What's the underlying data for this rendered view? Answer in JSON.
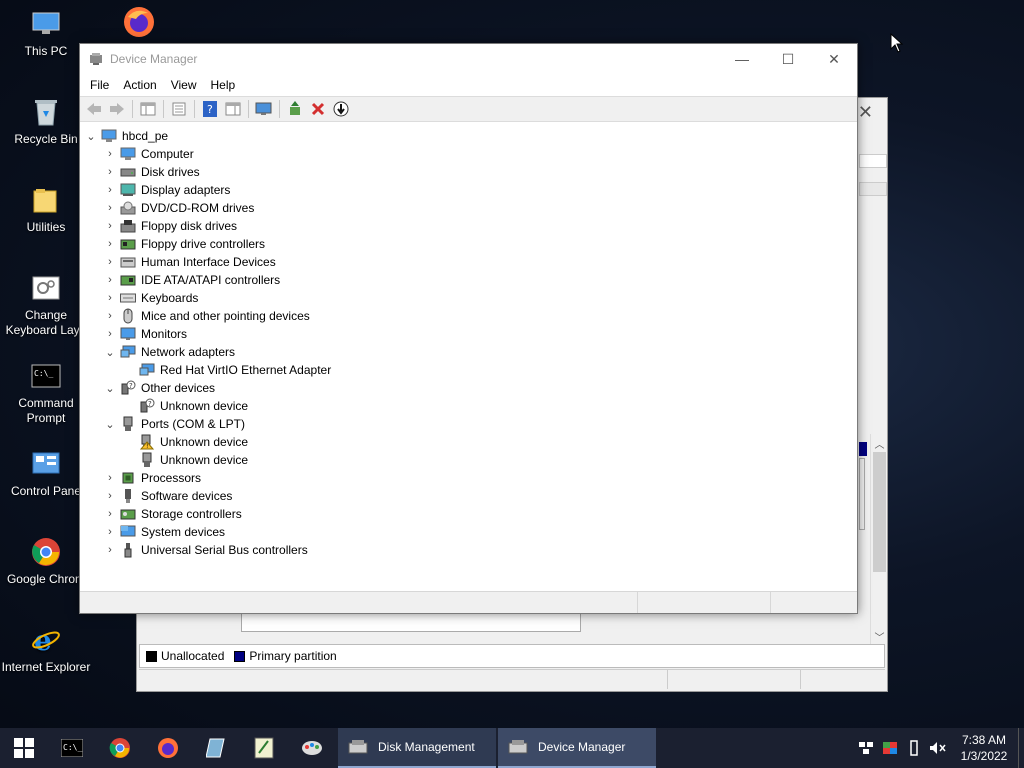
{
  "desktop": {
    "icons": [
      {
        "label": "This PC",
        "icon": "this-pc-icon"
      },
      {
        "label": "Recycle Bin",
        "icon": "recycle-bin-icon"
      },
      {
        "label": "Utilities",
        "icon": "folder-icon"
      },
      {
        "label": "Change Keyboard Layo",
        "icon": "keyboard-settings-icon"
      },
      {
        "label": "Command Prompt",
        "icon": "command-prompt-icon"
      },
      {
        "label": "Control Pane",
        "icon": "control-panel-icon"
      },
      {
        "label": "Google Chrom",
        "icon": "chrome-icon"
      },
      {
        "label": "Internet Explorer",
        "icon": "internet-explorer-icon"
      }
    ]
  },
  "disk_management": {
    "legend": {
      "unallocated": "Unallocated",
      "primary": "Primary partition"
    },
    "colors": {
      "unallocated": "#000000",
      "primary": "#000080"
    }
  },
  "device_manager": {
    "title": "Device Manager",
    "menu": [
      "File",
      "Action",
      "View",
      "Help"
    ],
    "root": "hbcd_pe",
    "tree": [
      {
        "label": "Computer",
        "icon": "computer-icon",
        "expanded": false
      },
      {
        "label": "Disk drives",
        "icon": "disk-drive-icon",
        "expanded": false
      },
      {
        "label": "Display adapters",
        "icon": "display-adapter-icon",
        "expanded": false
      },
      {
        "label": "DVD/CD-ROM drives",
        "icon": "dvd-drive-icon",
        "expanded": false
      },
      {
        "label": "Floppy disk drives",
        "icon": "floppy-drive-icon",
        "expanded": false
      },
      {
        "label": "Floppy drive controllers",
        "icon": "floppy-controller-icon",
        "expanded": false
      },
      {
        "label": "Human Interface Devices",
        "icon": "hid-icon",
        "expanded": false
      },
      {
        "label": "IDE ATA/ATAPI controllers",
        "icon": "ide-controller-icon",
        "expanded": false
      },
      {
        "label": "Keyboards",
        "icon": "keyboard-icon",
        "expanded": false
      },
      {
        "label": "Mice and other pointing devices",
        "icon": "mouse-icon",
        "expanded": false
      },
      {
        "label": "Monitors",
        "icon": "monitor-icon",
        "expanded": false
      },
      {
        "label": "Network adapters",
        "icon": "network-adapter-icon",
        "expanded": true,
        "children": [
          {
            "label": "Red Hat VirtIO Ethernet Adapter",
            "icon": "network-adapter-icon"
          }
        ]
      },
      {
        "label": "Other devices",
        "icon": "other-devices-icon",
        "expanded": true,
        "children": [
          {
            "label": "Unknown device",
            "icon": "unknown-device-icon"
          }
        ]
      },
      {
        "label": "Ports (COM & LPT)",
        "icon": "port-icon",
        "expanded": true,
        "children": [
          {
            "label": "Unknown device",
            "icon": "warning-port-icon"
          },
          {
            "label": "Unknown device",
            "icon": "port-icon"
          }
        ]
      },
      {
        "label": "Processors",
        "icon": "processor-icon",
        "expanded": false
      },
      {
        "label": "Software devices",
        "icon": "software-device-icon",
        "expanded": false
      },
      {
        "label": "Storage controllers",
        "icon": "storage-controller-icon",
        "expanded": false
      },
      {
        "label": "System devices",
        "icon": "system-devices-icon",
        "expanded": false
      },
      {
        "label": "Universal Serial Bus controllers",
        "icon": "usb-icon",
        "expanded": false
      }
    ]
  },
  "taskbar": {
    "apps": [
      {
        "label": "Disk Management",
        "icon": "disk-management-icon"
      },
      {
        "label": "Device Manager",
        "icon": "device-manager-icon"
      }
    ],
    "time": "7:38 AM",
    "date": "1/3/2022"
  }
}
